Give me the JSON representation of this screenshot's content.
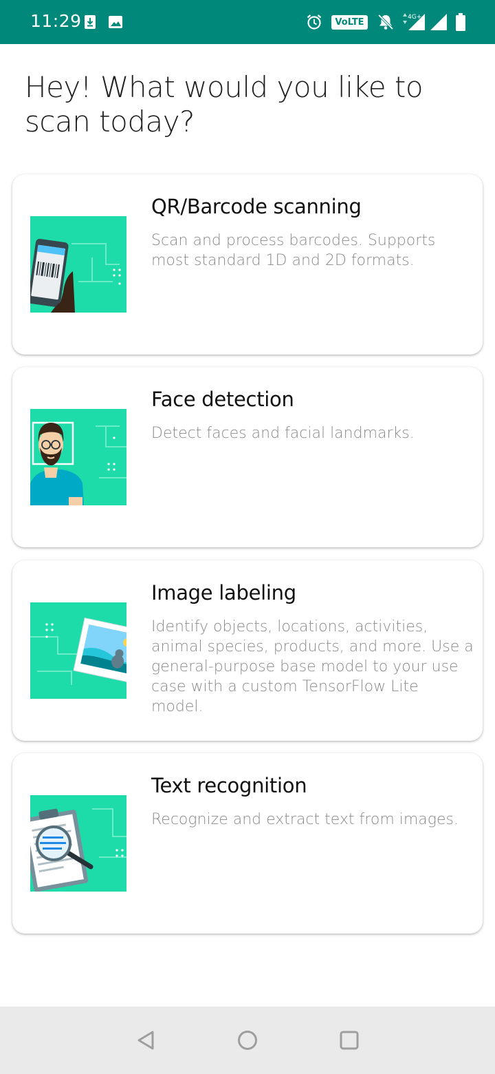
{
  "status_bar": {
    "time": "11:29",
    "icons": [
      "download-icon",
      "image-icon",
      "alarm-icon",
      "volte-badge",
      "notifications-off-icon",
      "signal-4g-icon",
      "signal-icon",
      "battery-icon"
    ],
    "volte_label": "VoLTE 1",
    "network_label": "4G+",
    "background": "#00897b"
  },
  "headline": "Hey! What would you like to scan today?",
  "cards": [
    {
      "title": "QR/Barcode scanning",
      "description": "Scan and process barcodes. Supports most standard 1D and 2D formats.",
      "thumbnail": "barcode-phone-illustration"
    },
    {
      "title": "Face detection",
      "description": "Detect faces and facial landmarks.",
      "thumbnail": "face-illustration"
    },
    {
      "title": "Image labeling",
      "description": "Identify objects, locations, activities, animal species, products, and more. Use a general-purpose base model to your use case with a custom TensorFlow Lite model.",
      "thumbnail": "photo-labeling-illustration"
    },
    {
      "title": "Text recognition",
      "description": "Recognize and extract text from images.",
      "thumbnail": "document-magnifier-illustration"
    }
  ],
  "nav_bar": {
    "buttons": [
      "back-icon",
      "home-icon",
      "recents-icon"
    ]
  },
  "colors": {
    "accent": "#00897b",
    "thumbnail_bg": "#1ddcaa"
  }
}
